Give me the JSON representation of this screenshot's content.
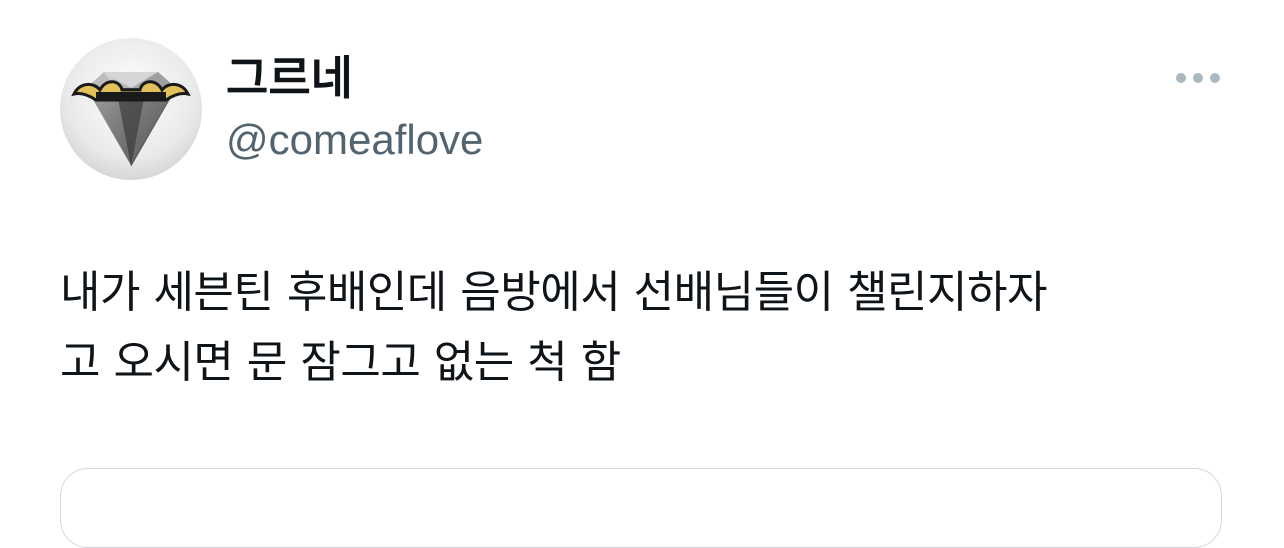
{
  "tweet": {
    "author": {
      "display_name": "그르네",
      "handle": "@comeaflove",
      "avatar_icon": "diamond-avatar-icon"
    },
    "more_icon": "more-horizontal-icon",
    "text_lines": [
      "내가 세븐틴 후배인데 음방에서 선배님들이 챌린지하자",
      "고 오시면 문 잠그고 없는 척 함"
    ]
  },
  "colors": {
    "text_primary": "#0f1419",
    "text_secondary": "#536471",
    "icon_gray": "#aab8c2",
    "border": "#cfd9de",
    "background": "#ffffff"
  }
}
